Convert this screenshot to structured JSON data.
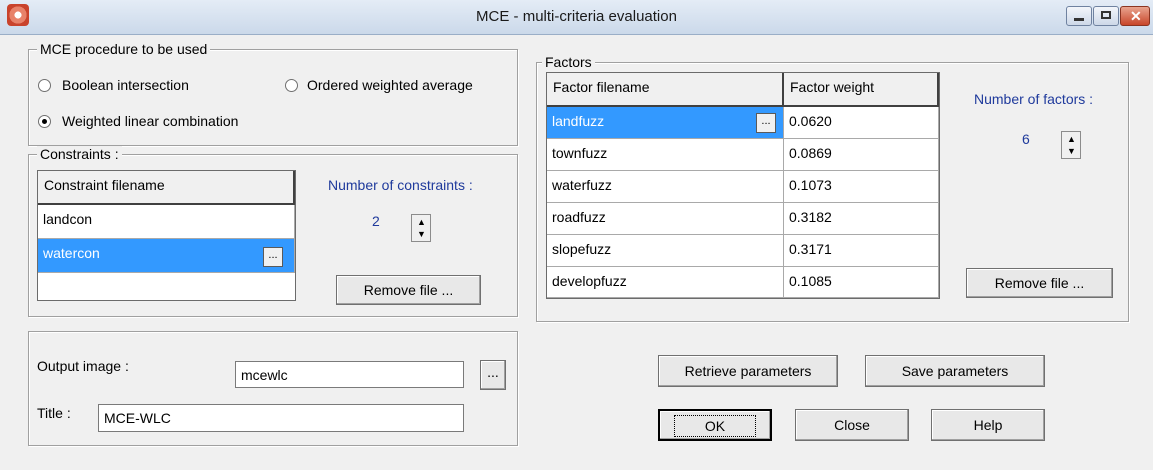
{
  "window": {
    "title": "MCE - multi-criteria evaluation"
  },
  "procedure": {
    "legend": "MCE procedure to be used",
    "options": [
      "Boolean intersection",
      "Ordered weighted average",
      "Weighted linear combination"
    ],
    "selected": "Weighted linear combination"
  },
  "constraints": {
    "legend": "Constraints :",
    "column_header": "Constraint filename",
    "rows": [
      "landcon",
      "watercon"
    ],
    "count_label": "Number of constraints :",
    "count": "2",
    "remove_label": "Remove file ..."
  },
  "factors": {
    "legend": "Factors",
    "col_filename": "Factor filename",
    "col_weight": "Factor weight",
    "rows": [
      {
        "name": "landfuzz",
        "weight": "0.0620"
      },
      {
        "name": "townfuzz",
        "weight": "0.0869"
      },
      {
        "name": "waterfuzz",
        "weight": "0.1073"
      },
      {
        "name": "roadfuzz",
        "weight": "0.3182"
      },
      {
        "name": "slopefuzz",
        "weight": "0.3171"
      },
      {
        "name": "developfuzz",
        "weight": "0.1085"
      }
    ],
    "count_label": "Number of factors :",
    "count": "6",
    "remove_label": "Remove file ..."
  },
  "output": {
    "image_label": "Output image :",
    "image_value": "mcewlc",
    "title_label": "Title :",
    "title_value": "MCE-WLC",
    "browse": "..."
  },
  "buttons": {
    "retrieve": "Retrieve parameters",
    "save": "Save parameters",
    "ok": "OK",
    "close": "Close",
    "help": "Help"
  }
}
